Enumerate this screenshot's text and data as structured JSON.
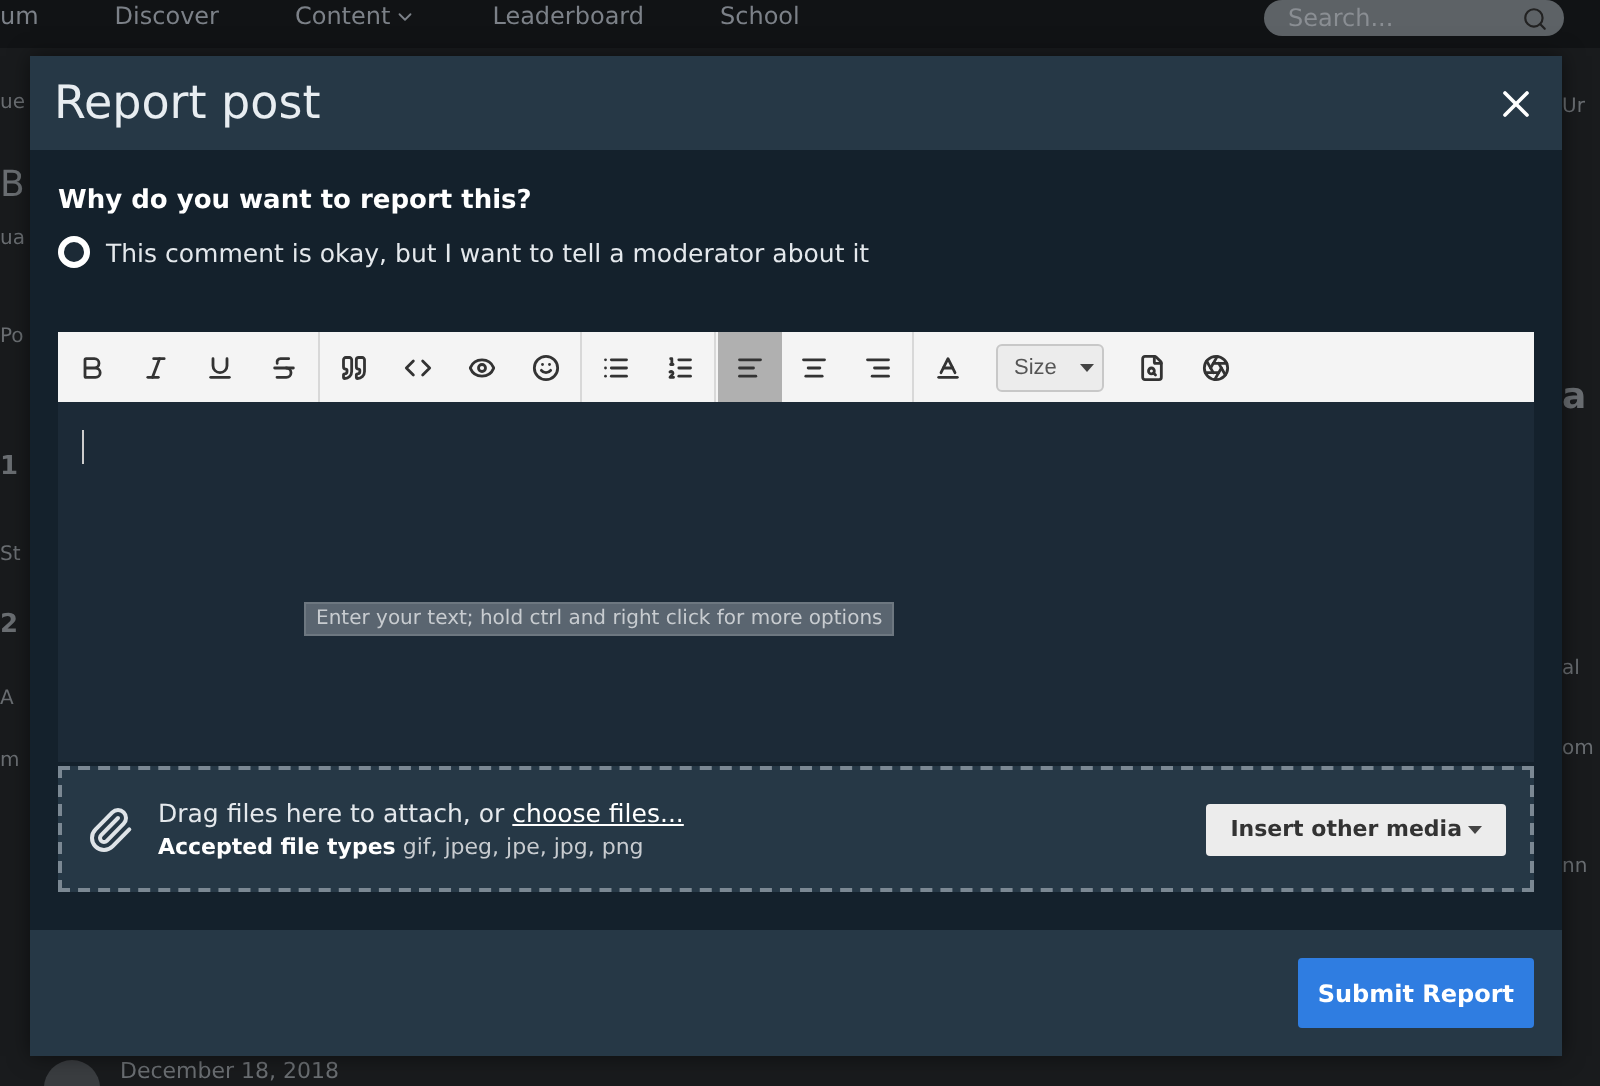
{
  "nav": {
    "items": [
      {
        "label": "um",
        "caret": false
      },
      {
        "label": "Discover",
        "caret": false
      },
      {
        "label": "Content",
        "caret": true
      },
      {
        "label": "Leaderboard",
        "caret": false
      },
      {
        "label": "School",
        "caret": false
      }
    ],
    "search": {
      "placeholder": "Search..."
    }
  },
  "background": {
    "left_fragments": [
      "ue",
      "B",
      "ua",
      "Po",
      "1",
      "St",
      "2",
      "A",
      "m"
    ],
    "right_fragments": [
      "Ur",
      "a",
      "al",
      "om",
      "nn"
    ],
    "date": "December 18, 2018"
  },
  "dialog": {
    "title": "Report post",
    "question": "Why do you want to report this?",
    "options": [
      {
        "label": "This comment is okay, but I want to tell a moderator about it",
        "selected": true
      }
    ],
    "toolbar": [
      [
        {
          "kind": "bold",
          "selected": false
        },
        {
          "kind": "italic",
          "selected": false
        },
        {
          "kind": "underline",
          "selected": false
        },
        {
          "kind": "strike",
          "selected": false
        }
      ],
      [
        {
          "kind": "quote",
          "selected": false
        },
        {
          "kind": "code",
          "selected": false
        },
        {
          "kind": "spoiler",
          "selected": false
        },
        {
          "kind": "emoji",
          "selected": false
        }
      ],
      [
        {
          "kind": "bullets",
          "selected": false
        },
        {
          "kind": "numbers",
          "selected": false
        }
      ],
      [
        {
          "kind": "align-left",
          "selected": true
        },
        {
          "kind": "align-center",
          "selected": false
        },
        {
          "kind": "align-right",
          "selected": false
        }
      ],
      [
        {
          "kind": "text-color",
          "selected": false
        },
        {
          "kind": "size",
          "label": "Size",
          "selected": false
        },
        {
          "kind": "preview",
          "selected": false
        },
        {
          "kind": "sources",
          "selected": false
        }
      ]
    ],
    "editor_tooltip": "Enter your text; hold ctrl and right click for more options",
    "attach": {
      "text": "Drag files here to attach, or",
      "link": "choose files...",
      "types_label": "Accepted file types",
      "types": "gif, jpeg, jpe, jpg, png",
      "media_button": "Insert other media"
    },
    "submit": "Submit Report"
  }
}
